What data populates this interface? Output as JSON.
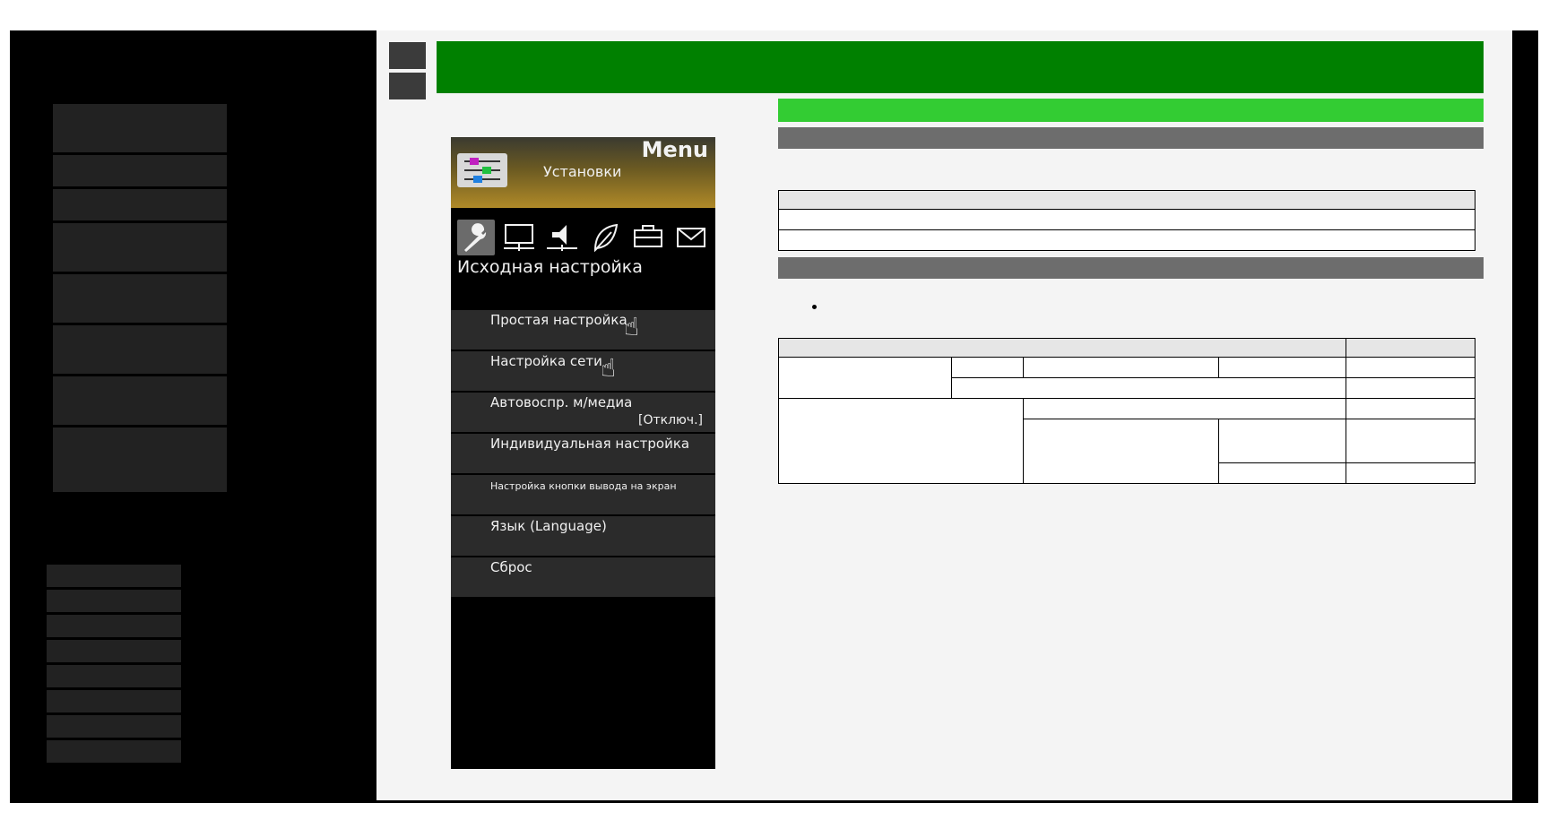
{
  "tv_menu": {
    "menu_label": "Menu",
    "header_title": "Установки",
    "header_icon": "settings-sliders-icon",
    "icons": [
      "wrench-icon",
      "monitor-icon",
      "speaker-icon",
      "leaf-icon",
      "toolbox-icon",
      "envelope-icon"
    ],
    "section_title": "Исходная настройка",
    "items": [
      {
        "label": "Простая настройка",
        "value": ""
      },
      {
        "label": "Настройка сети",
        "value": ""
      },
      {
        "label": "Автовоспр. м/медиа",
        "value": "[Отключ.]"
      },
      {
        "label": "Индивидуальная настройка",
        "value": ""
      },
      {
        "label": "Настройка кнопки вывода на экран",
        "value": ""
      },
      {
        "label": "Язык (Language)",
        "value": ""
      },
      {
        "label": "Сброс",
        "value": ""
      }
    ]
  },
  "colors": {
    "header_green": "#008000",
    "subheader_lime": "#33cc33",
    "section_grey": "#6d6d6d",
    "nav_block": "#222222"
  }
}
